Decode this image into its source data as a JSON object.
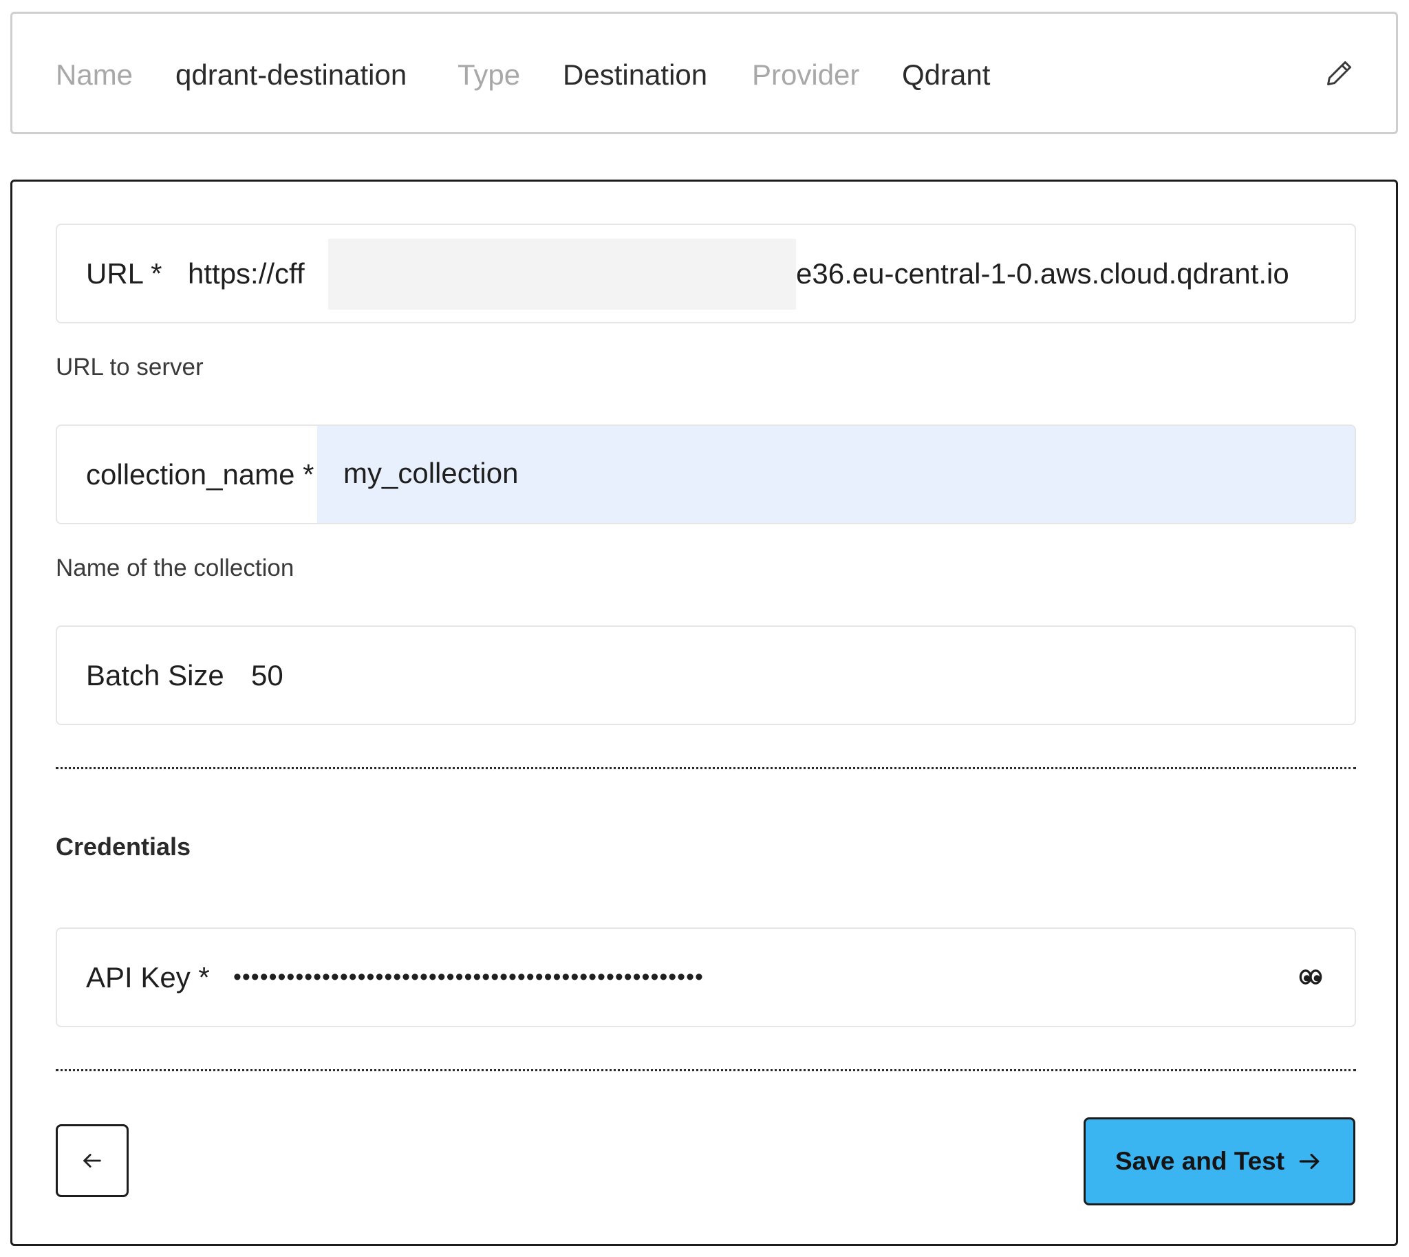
{
  "header": {
    "name_label": "Name",
    "name_value": "qdrant-destination",
    "type_label": "Type",
    "type_value": "Destination",
    "provider_label": "Provider",
    "provider_value": "Qdrant",
    "edit_icon": "pencil-icon"
  },
  "form": {
    "url": {
      "label": "URL *",
      "value_start": "https://cff",
      "value_end": "e36.eu-central-1-0.aws.cloud.qdrant.io",
      "helper": "URL to server"
    },
    "collection": {
      "label": "collection_name *",
      "value": "my_collection",
      "helper": "Name of the collection"
    },
    "batch": {
      "label": "Batch Size",
      "value": "50"
    },
    "credentials": {
      "title": "Credentials",
      "api_key_label": "API Key *",
      "api_key_masked": "•••••••••••••••••••••••••••••••••••••••••••••••••••••",
      "reveal_icon": "eye-icon"
    },
    "actions": {
      "back_icon": "arrow-left-icon",
      "save_label": "Save and Test",
      "save_icon": "arrow-right-icon"
    }
  },
  "colors": {
    "accent_button": "#3bb4f2",
    "autofill_background": "#e8effd",
    "label_muted": "#a8a8a8"
  }
}
